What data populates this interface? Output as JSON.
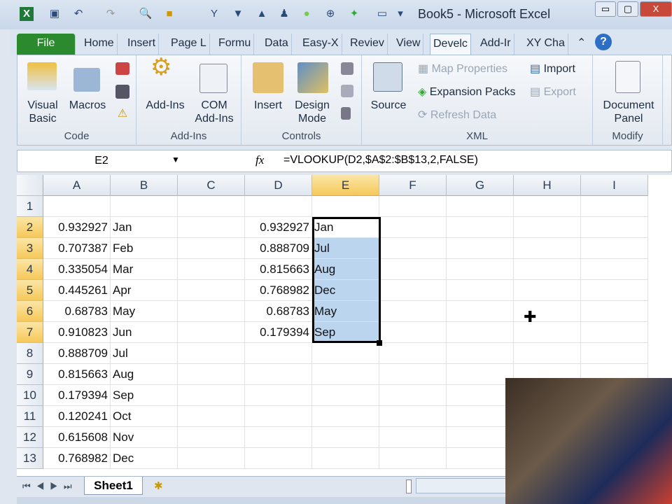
{
  "window": {
    "title": "Book5 - Microsoft Excel"
  },
  "tabs": [
    "File",
    "Home",
    "Insert",
    "Page L",
    "Formu",
    "Data",
    "Easy-X",
    "Reviev",
    "View",
    "Develc",
    "Add-Ir",
    "XY Cha"
  ],
  "ribbon": {
    "code": {
      "label": "Code",
      "visual_basic": "Visual Basic",
      "macros": "Macros"
    },
    "addins": {
      "label": "Add-Ins",
      "addins": "Add-Ins",
      "com": "COM Add-Ins"
    },
    "controls": {
      "label": "Controls",
      "insert": "Insert",
      "design": "Design Mode"
    },
    "xml": {
      "label": "XML",
      "source": "Source",
      "map_properties": "Map Properties",
      "expansion_packs": "Expansion Packs",
      "refresh_data": "Refresh Data",
      "import": "Import",
      "export": "Export"
    },
    "modify": {
      "label": "Modify",
      "document_panel": "Document Panel"
    }
  },
  "formula_bar": {
    "name_box": "E2",
    "fx": "fx",
    "formula": "=VLOOKUP(D2,$A$2:$B$13,2,FALSE)"
  },
  "columns": [
    "A",
    "B",
    "C",
    "D",
    "E",
    "F",
    "G",
    "H",
    "I"
  ],
  "rows": [
    {
      "n": "1",
      "A": "",
      "B": "",
      "D": "",
      "E": ""
    },
    {
      "n": "2",
      "A": "0.932927",
      "B": "Jan",
      "D": "0.932927",
      "E": "Jan"
    },
    {
      "n": "3",
      "A": "0.707387",
      "B": "Feb",
      "D": "0.888709",
      "E": "Jul"
    },
    {
      "n": "4",
      "A": "0.335054",
      "B": "Mar",
      "D": "0.815663",
      "E": "Aug"
    },
    {
      "n": "5",
      "A": "0.445261",
      "B": "Apr",
      "D": "0.768982",
      "E": "Dec"
    },
    {
      "n": "6",
      "A": "0.68783",
      "B": "May",
      "D": "0.68783",
      "E": "May"
    },
    {
      "n": "7",
      "A": "0.910823",
      "B": "Jun",
      "D": "0.179394",
      "E": "Sep"
    },
    {
      "n": "8",
      "A": "0.888709",
      "B": "Jul",
      "D": "",
      "E": ""
    },
    {
      "n": "9",
      "A": "0.815663",
      "B": "Aug",
      "D": "",
      "E": ""
    },
    {
      "n": "10",
      "A": "0.179394",
      "B": "Sep",
      "D": "",
      "E": ""
    },
    {
      "n": "11",
      "A": "0.120241",
      "B": "Oct",
      "D": "",
      "E": ""
    },
    {
      "n": "12",
      "A": "0.615608",
      "B": "Nov",
      "D": "",
      "E": ""
    },
    {
      "n": "13",
      "A": "0.768982",
      "B": "Dec",
      "D": "",
      "E": ""
    }
  ],
  "sheet_tabs": [
    "Sheet1"
  ]
}
